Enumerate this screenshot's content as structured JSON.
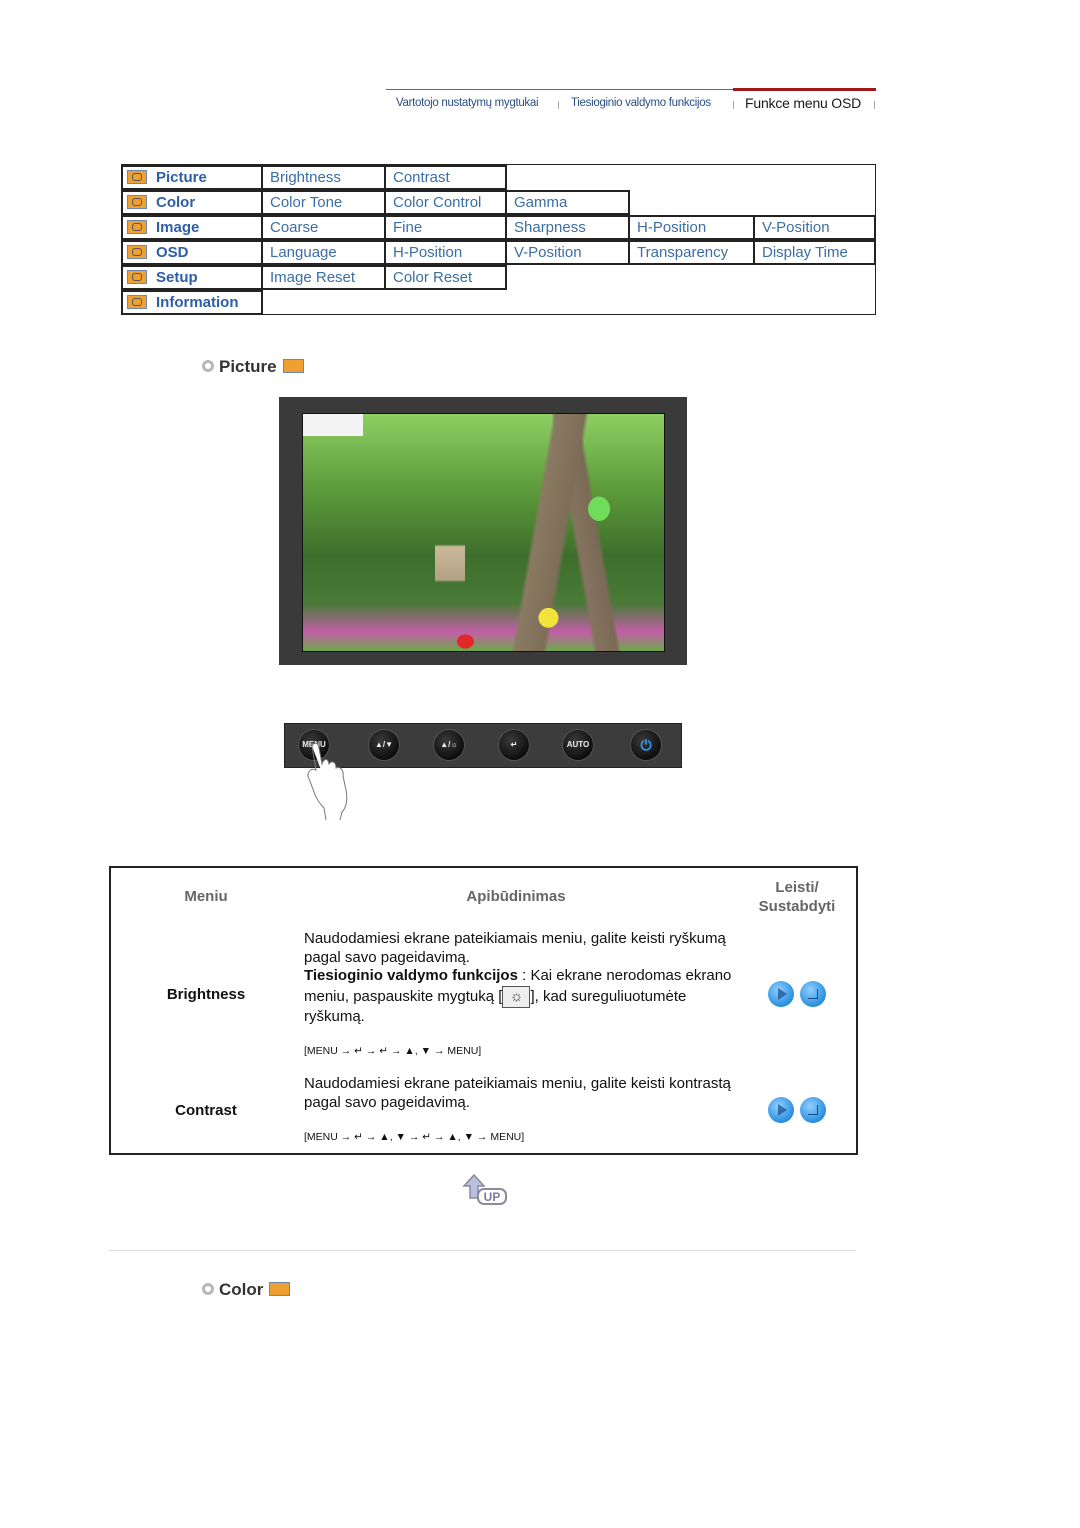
{
  "topnav": {
    "items": [
      {
        "label": "Vartotojo nustatymų mygtukai",
        "active": false
      },
      {
        "label": "Tiesioginio valdymo funkcijos",
        "active": false
      },
      {
        "label": "Funkce menu OSD",
        "active": true
      }
    ]
  },
  "osd_menu": {
    "rows": [
      {
        "main": "Picture",
        "icon": "picture-icon",
        "subs": [
          "Brightness",
          "Contrast"
        ]
      },
      {
        "main": "Color",
        "icon": "color-icon",
        "subs": [
          "Color Tone",
          "Color Control",
          "Gamma"
        ]
      },
      {
        "main": "Image",
        "icon": "image-icon",
        "subs": [
          "Coarse",
          "Fine",
          "Sharpness",
          "H-Position",
          "V-Position"
        ]
      },
      {
        "main": "OSD",
        "icon": "osd-icon",
        "subs": [
          "Language",
          "H-Position",
          "V-Position",
          "Transparency",
          "Display Time"
        ]
      },
      {
        "main": "Setup",
        "icon": "setup-icon",
        "subs": [
          "Image Reset",
          "Color Reset"
        ]
      },
      {
        "main": "Information",
        "icon": "information-icon",
        "subs": []
      }
    ]
  },
  "picture_section": {
    "title": "Picture",
    "button_bar": {
      "buttons": [
        "MENU",
        "▲/▼",
        "▲/☼",
        "↵",
        "AUTO",
        "power"
      ]
    }
  },
  "desc_table": {
    "headers": {
      "menu": "Meniu",
      "description": "Apibūdinimas",
      "play": "Leisti/\nSustabdyti"
    },
    "rows": [
      {
        "menu": "Brightness",
        "text1": "Naudodamiesi ekrane pateikiamais meniu, galite keisti ryškumą pagal savo pageidavimą.",
        "bold": "Tiesioginio valdymo funkcijos",
        "text2": " : Kai ekrane nerodomas ekrano meniu, paspauskite mygtuką [",
        "text3": "], kad sureguliuotumėte ryškumą.",
        "seq": "[MENU → ↵ → ↵ → ▲, ▼ → MENU]"
      },
      {
        "menu": "Contrast",
        "text1": "Naudodamiesi ekrane pateikiamais meniu, galite keisti kontrastą pagal savo pageidavimą.",
        "seq": "[MENU → ↵ → ▲, ▼ → ↵ → ▲, ▼ → MENU]"
      }
    ]
  },
  "up_label": "UP",
  "color_section": {
    "title": "Color"
  }
}
